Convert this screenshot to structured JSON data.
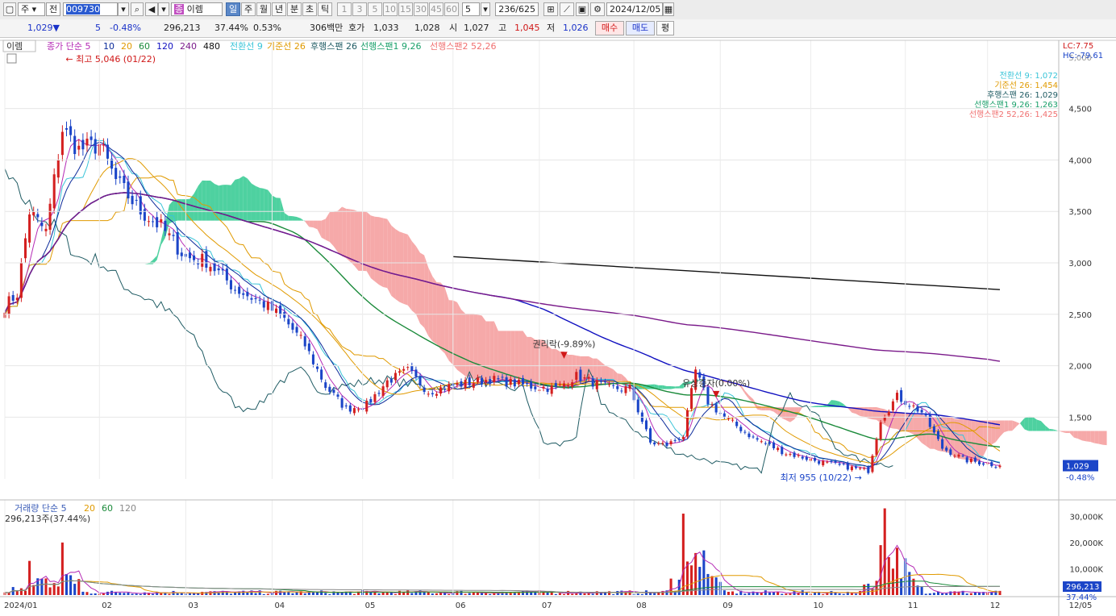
{
  "toolbar": {
    "market": "주",
    "prev": "전",
    "code": "009730",
    "name": "이렘",
    "periods": [
      "일",
      "주",
      "월",
      "년",
      "분",
      "초",
      "틱"
    ],
    "selected_period": "일",
    "intervals": [
      "1",
      "3",
      "5",
      "10",
      "15",
      "30",
      "45",
      "60"
    ],
    "interval_value": "5",
    "count": "236/625",
    "date": "2024/12/05"
  },
  "quote": {
    "price": "1,029▼",
    "change": "5",
    "change_pct": "-0.48%",
    "volume": "296,213",
    "turnover_pct": "37.44%",
    "ratio": "0.53%",
    "amount": "306백만",
    "ask_label": "호가",
    "ask": "1,033",
    "bid": "1,028",
    "open_label": "시",
    "open": "1,027",
    "high_label": "고",
    "high": "1,045",
    "low_label": "저",
    "low": "1,026",
    "buy_label": "매수",
    "sell_label": "매도",
    "eval_label": "평"
  },
  "legend": {
    "stock": "이렘",
    "ma_label": "종가 단순 5",
    "ma_periods": [
      "10",
      "20",
      "60",
      "120",
      "240",
      "480"
    ],
    "ichimoku": [
      "전환선 9",
      "기준선 26",
      "후행스팬 26",
      "선행스팬1 9,26",
      "선행스팬2 52,26"
    ]
  },
  "indicator_values": [
    {
      "text": "전환선 9: 1,072",
      "color": "#39c4d8"
    },
    {
      "text": "기준선 26: 1,454",
      "color": "#e09a00"
    },
    {
      "text": "후행스팬 26: 1,029",
      "color": "#1f5b63"
    },
    {
      "text": "선행스팬1 9,26: 1,263",
      "color": "#1aa06a"
    },
    {
      "text": "선행스팬2 52,26: 1,425",
      "color": "#f07070"
    }
  ],
  "lc_hc": {
    "lc": "LC:7.75",
    "hc": "HC:-79.61"
  },
  "annotations": {
    "high": "최고 5,046 (01/22)",
    "low": "최저 955 (10/22)",
    "rights": "권리락(-9.89%)",
    "paid_increase": "유상증자(0.00%)"
  },
  "price_axis": {
    "ticks": [
      "4,500",
      "4,000",
      "3,500",
      "3,000",
      "2,500",
      "2,000",
      "1,500"
    ],
    "top_tick": "5,000"
  },
  "volume_axis": {
    "ticks": [
      "30,000K",
      "20,000K",
      "10,000K"
    ]
  },
  "right_labels": {
    "price": "1,029",
    "pct": "-0.48%",
    "vol": "296,213",
    "vol_pct": "37.44%"
  },
  "volume_legend": {
    "title": "거래량 단순 5",
    "periods": [
      "20",
      "60",
      "120"
    ],
    "value": "296,213주(37.44%)"
  },
  "x_axis": [
    "2024/01",
    "02",
    "03",
    "04",
    "05",
    "06",
    "07",
    "08",
    "09",
    "10",
    "11",
    "12"
  ],
  "x_end_label": "12/05",
  "colors": {
    "up": "#d42020",
    "down": "#1b45c8",
    "ma5": "#b52ab5",
    "ma10": "#0b2a9a",
    "ma20": "#e09a00",
    "ma60": "#1a8a3a",
    "ma120": "#1010c0",
    "ma240": "#7a1a8a",
    "ma480": "#111111",
    "cloud_up": "#f59a9a",
    "cloud_down": "#2fc98f"
  },
  "chart_data": {
    "type": "candlestick",
    "title": "",
    "y_range": [
      900,
      5100
    ],
    "volume_range_k": [
      0,
      35000
    ],
    "x_months": [
      "2024/01",
      "02",
      "03",
      "04",
      "05",
      "06",
      "07",
      "08",
      "09",
      "10",
      "11",
      "12"
    ],
    "anchors": [
      {
        "date": "2024-01-02",
        "close": 2580
      },
      {
        "date": "2024-01-05",
        "close": 2700
      },
      {
        "date": "2024-01-10",
        "close": 3500
      },
      {
        "date": "2024-01-16",
        "close": 3300
      },
      {
        "date": "2024-01-22",
        "close": 4300
      },
      {
        "date": "2024-01-26",
        "close": 4100
      },
      {
        "date": "2024-02-02",
        "close": 4150
      },
      {
        "date": "2024-02-08",
        "close": 3800
      },
      {
        "date": "2024-02-16",
        "close": 3500
      },
      {
        "date": "2024-02-23",
        "close": 3350
      },
      {
        "date": "2024-03-04",
        "close": 3050
      },
      {
        "date": "2024-03-11",
        "close": 3020
      },
      {
        "date": "2024-03-20",
        "close": 2750
      },
      {
        "date": "2024-03-29",
        "close": 2600
      },
      {
        "date": "2024-04-05",
        "close": 2450
      },
      {
        "date": "2024-04-12",
        "close": 2200
      },
      {
        "date": "2024-04-19",
        "close": 1800
      },
      {
        "date": "2024-04-26",
        "close": 1580
      },
      {
        "date": "2024-05-03",
        "close": 1620
      },
      {
        "date": "2024-05-10",
        "close": 1850
      },
      {
        "date": "2024-05-17",
        "close": 1950
      },
      {
        "date": "2024-05-24",
        "close": 1750
      },
      {
        "date": "2024-05-31",
        "close": 1800
      },
      {
        "date": "2024-06-14",
        "close": 1870
      },
      {
        "date": "2024-06-28",
        "close": 1800
      },
      {
        "date": "2024-07-08",
        "close": 1780
      },
      {
        "date": "2024-07-15",
        "close": 1900
      },
      {
        "date": "2024-07-25",
        "close": 1780
      },
      {
        "date": "2024-08-01",
        "close": 1780
      },
      {
        "date": "2024-08-08",
        "close": 1250
      },
      {
        "date": "2024-08-14",
        "close": 1230
      },
      {
        "date": "2024-08-20",
        "close": 1320
      },
      {
        "date": "2024-08-23",
        "close": 1950
      },
      {
        "date": "2024-08-28",
        "close": 1650
      },
      {
        "date": "2024-09-03",
        "close": 1500
      },
      {
        "date": "2024-09-12",
        "close": 1300
      },
      {
        "date": "2024-09-24",
        "close": 1150
      },
      {
        "date": "2024-10-08",
        "close": 1050
      },
      {
        "date": "2024-10-22",
        "close": 980
      },
      {
        "date": "2024-10-25",
        "close": 1480
      },
      {
        "date": "2024-10-31",
        "close": 1700
      },
      {
        "date": "2024-11-08",
        "close": 1550
      },
      {
        "date": "2024-11-15",
        "close": 1200
      },
      {
        "date": "2024-11-25",
        "close": 1080
      },
      {
        "date": "2024-12-05",
        "close": 1029
      }
    ],
    "volume_spikes_k": [
      {
        "date": "2024-01-10",
        "value": 13000
      },
      {
        "date": "2024-01-22",
        "value": 20000
      },
      {
        "date": "2024-08-20",
        "value": 31000
      },
      {
        "date": "2024-08-23",
        "value": 16000
      },
      {
        "date": "2024-08-27",
        "value": 17000
      },
      {
        "date": "2024-10-25",
        "value": 19000
      },
      {
        "date": "2024-10-28",
        "value": 33000
      },
      {
        "date": "2024-10-31",
        "value": 18000
      },
      {
        "date": "2024-11-04",
        "value": 14000
      }
    ]
  }
}
